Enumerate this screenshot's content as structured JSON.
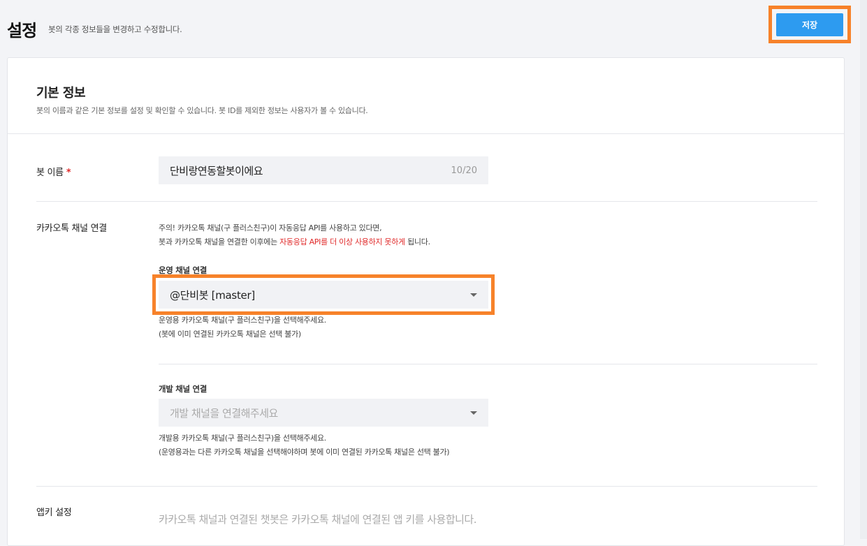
{
  "header": {
    "title": "설정",
    "description": "봇의 각종 정보들을 변경하고 수정합니다.",
    "save_label": "저장",
    "highlight_color": "#f7822a",
    "primary_color": "#2d9bf0"
  },
  "basic_info": {
    "title": "기본 정보",
    "description": "봇의 이름과 같은 기본 정보를 설정 및 확인할 수 있습니다. 봇 ID를 제외한 정보는 사용자가 볼 수 있습니다."
  },
  "bot_name": {
    "label": "봇 이름",
    "required_mark": "*",
    "value": "단비랑연동할봇이에요",
    "counter": "10/20"
  },
  "kakao_channel": {
    "label": "카카오톡 채널 연결",
    "notice_line1": "주의! 카카오톡 채널(구 플러스친구)이 자동응답 API를 사용하고 있다면,",
    "notice_line2_before": "봇과 카카오톡 채널을 연결한 이후에는 ",
    "notice_line2_warning": "자동응답 API를 더 이상 사용하지 못하게",
    "notice_line2_after": " 됩니다.",
    "operating": {
      "label": "운영 채널 연결",
      "selected": "@단비봇 [master]",
      "help_line1": "운영용 카카오톡 채널(구 플러스친구)을 선택해주세요.",
      "help_line2": "(봇에 이미 연결된 카카오톡 채널은 선택 불가)"
    },
    "development": {
      "label": "개발 채널 연결",
      "placeholder": "개발 채널을 연결해주세요",
      "help_line1": "개발용 카카오톡 채널(구 플러스친구)을 선택해주세요.",
      "help_line2": "(운영용과는 다른 카카오톡 채널을 선택해야하며 봇에 이미 연결된 카카오톡 채널은 선택 불가)"
    }
  },
  "app_key": {
    "label": "앱키 설정",
    "description": "카카오톡 채널과 연결된 챗봇은 카카오톡 채널에 연결된 앱 키를 사용합니다."
  }
}
